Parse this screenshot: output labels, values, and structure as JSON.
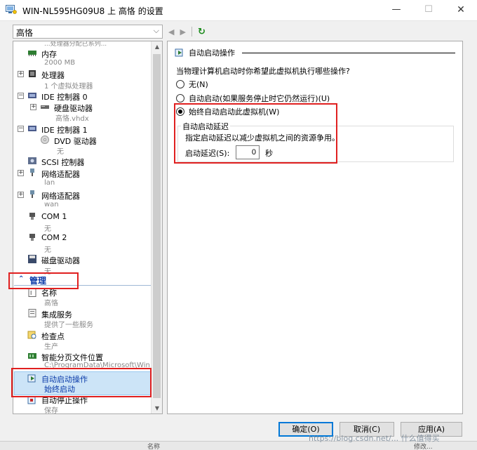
{
  "window": {
    "title": "WIN-NL595HG09U8 上 高恪 的设置",
    "minimize": "—",
    "maximize": "☐",
    "close": "✕"
  },
  "vm_selector": {
    "value": "高恪"
  },
  "left_tree": {
    "top_cut_text": "...处理器分配已系列...",
    "items": [
      {
        "name": "内存",
        "sub": "2000 MB"
      },
      {
        "name": "处理器",
        "sub": "1 个虚拟处理器"
      },
      {
        "name": "IDE 控制器 0",
        "sub": ""
      },
      {
        "name": "硬盘驱动器",
        "sub": "高恪.vhdx"
      },
      {
        "name": "IDE 控制器 1",
        "sub": ""
      },
      {
        "name": "DVD 驱动器",
        "sub": "无"
      },
      {
        "name": "SCSI 控制器",
        "sub": ""
      },
      {
        "name": "网络适配器",
        "sub": "lan"
      },
      {
        "name": "网络适配器",
        "sub": "wan"
      },
      {
        "name": "COM 1",
        "sub": "无"
      },
      {
        "name": "COM 2",
        "sub": "无"
      },
      {
        "name": "磁盘驱动器",
        "sub": "无"
      }
    ],
    "management_header": "管理",
    "management_items": [
      {
        "name": "名称",
        "sub": "高恪"
      },
      {
        "name": "集成服务",
        "sub": "提供了一些服务"
      },
      {
        "name": "检查点",
        "sub": "生产"
      },
      {
        "name": "智能分页文件位置",
        "sub": "C:\\ProgramData\\Microsoft\\Win..."
      },
      {
        "name": "自动启动操作",
        "sub": "始终启动"
      },
      {
        "name": "自动停止操作",
        "sub": "保存"
      }
    ]
  },
  "right": {
    "section_title": "自动启动操作",
    "question": "当物理计算机启动时你希望此虚拟机执行哪些操作?",
    "options": [
      {
        "label": "无(N)",
        "selected": false
      },
      {
        "label": "自动启动(如果服务停止时它仍然运行)(U)",
        "selected": false
      },
      {
        "label": "始终自动启动此虚拟机(W)",
        "selected": true
      }
    ],
    "delay_group_label": "自动启动延迟",
    "delay_desc": "指定启动延迟以减少虚拟机之间的资源争用。",
    "delay_label": "启动延迟(S):",
    "delay_value": "0",
    "delay_unit": "秒"
  },
  "buttons": {
    "ok": "确定(O)",
    "cancel": "取消(C)",
    "apply": "应用(A)"
  },
  "watermark": "https://blog.csdn.net/...  什么值得买",
  "bottom_bits": [
    "名称",
    "修改..."
  ],
  "colors": {
    "accent_red": "#e02020",
    "selection": "#cce4f7",
    "link_blue": "#0a3aa8"
  }
}
